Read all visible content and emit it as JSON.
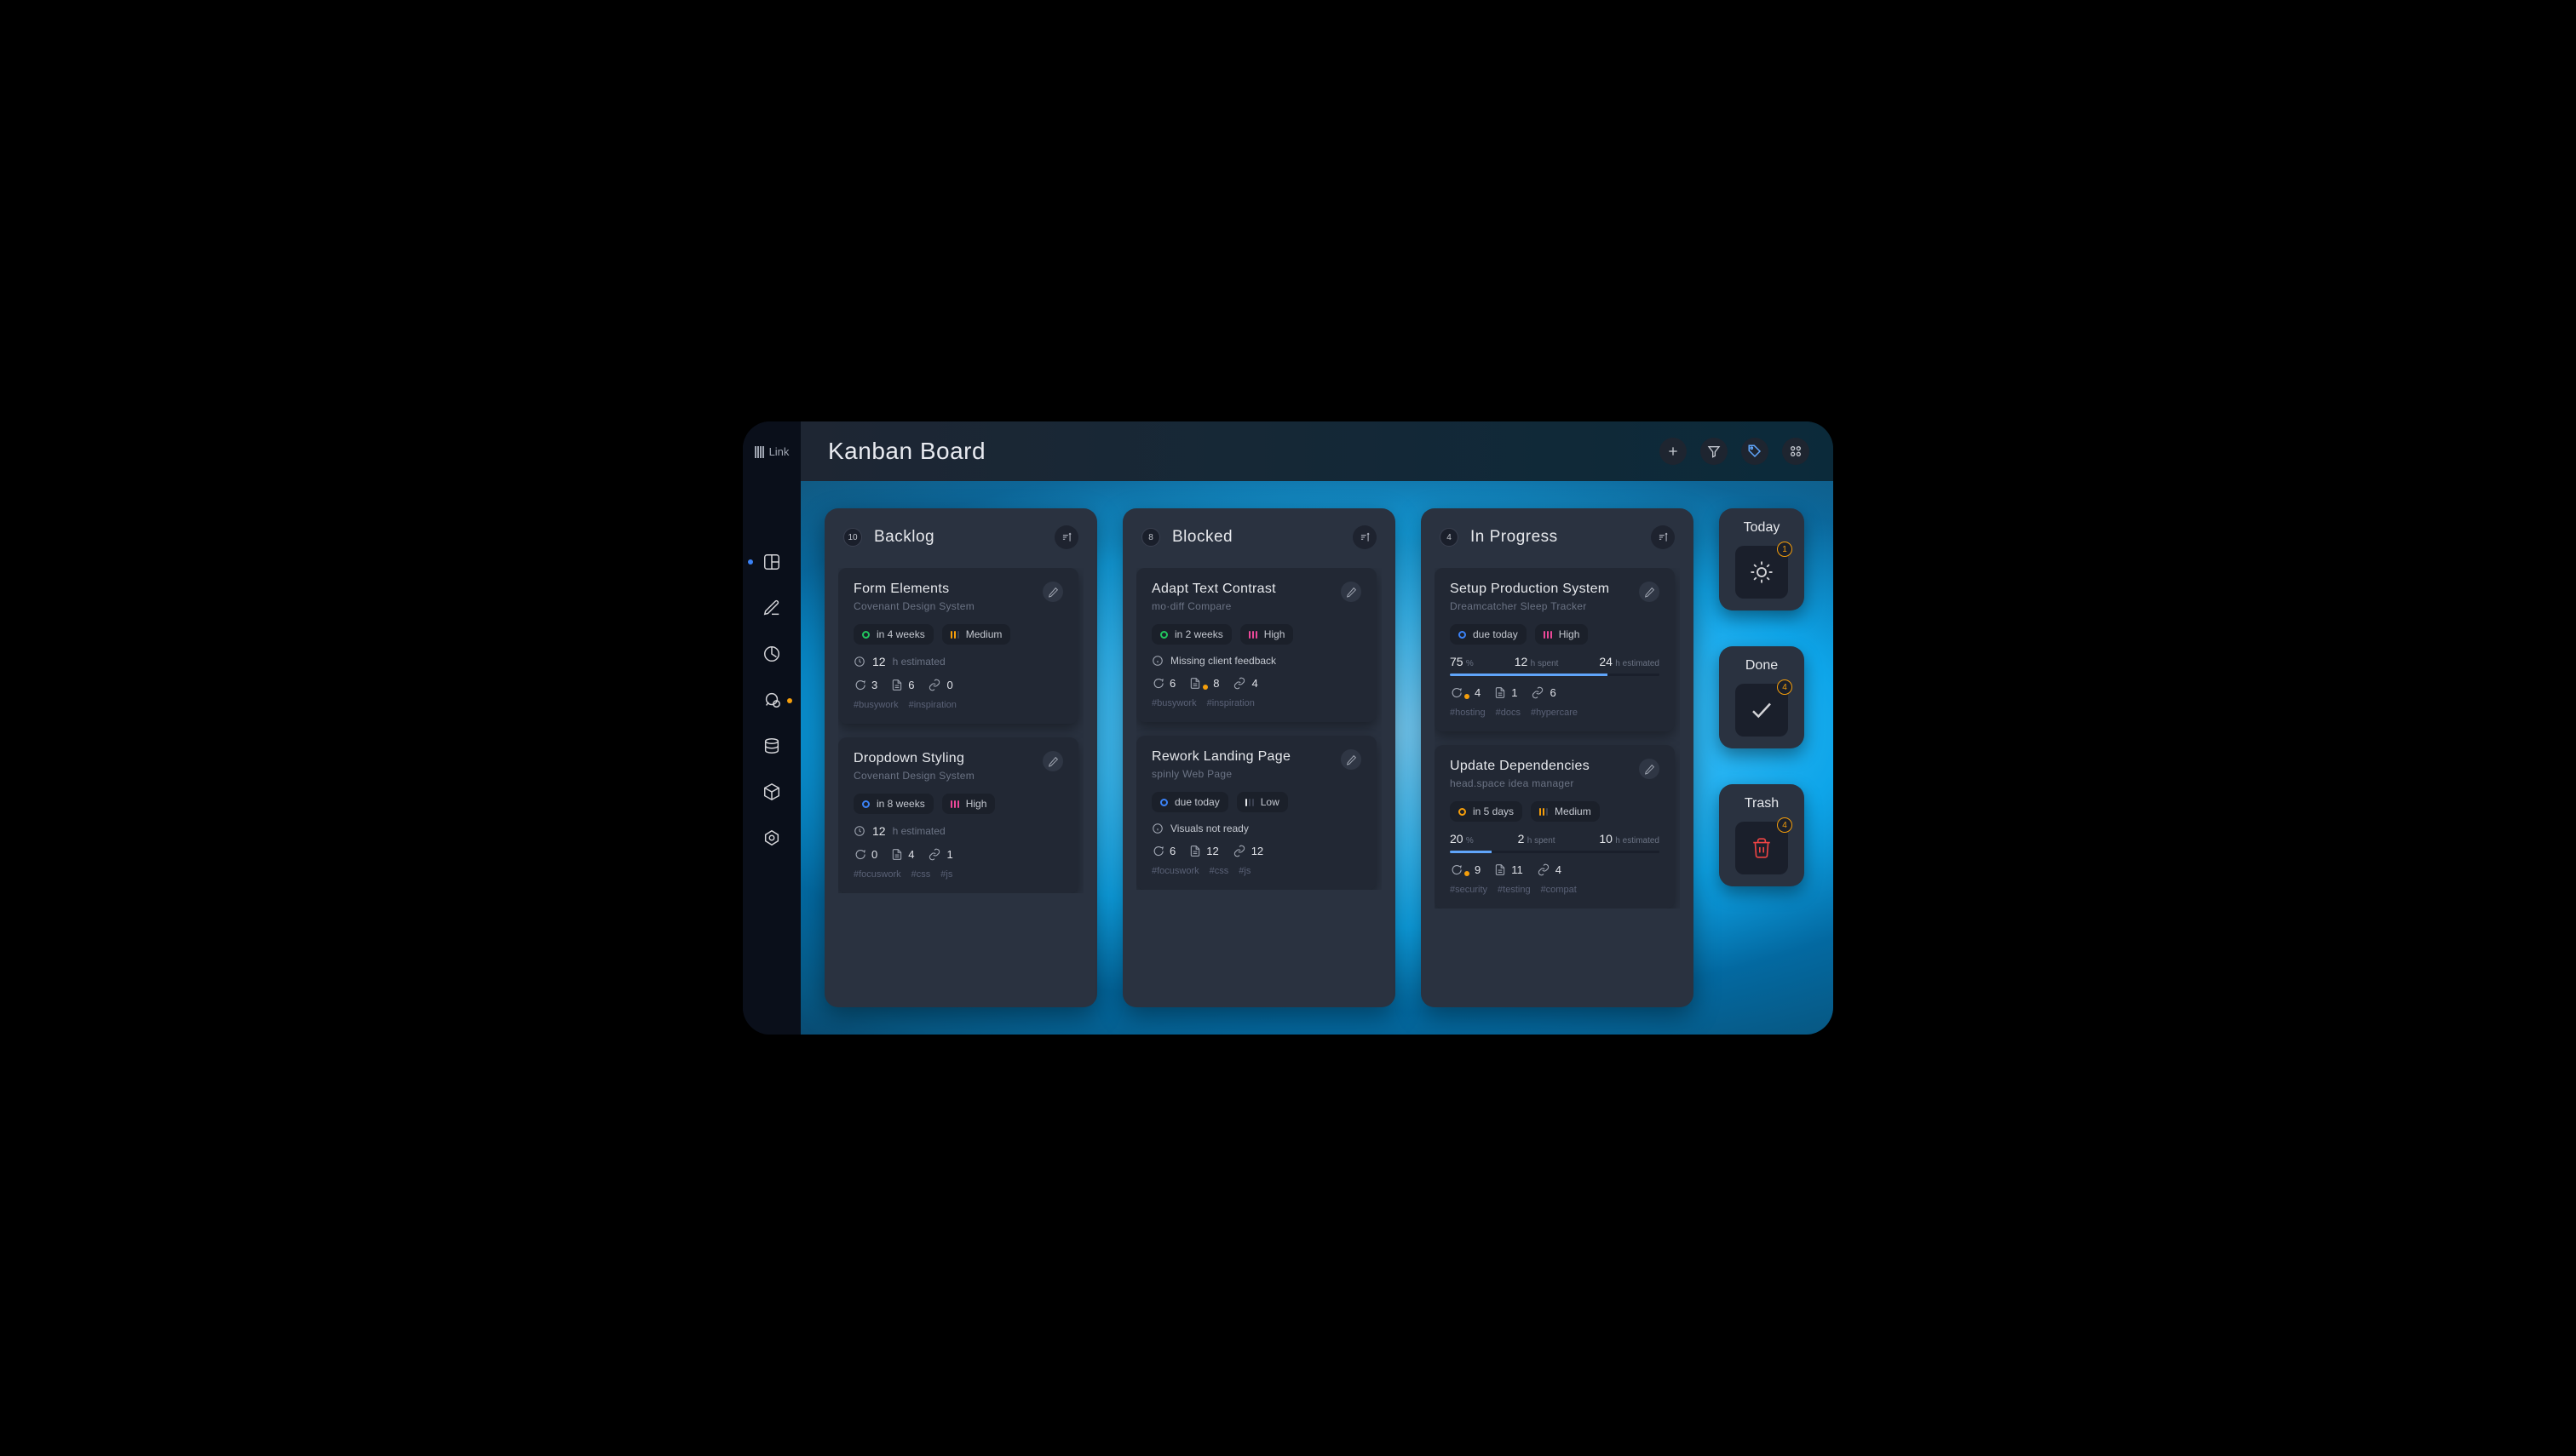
{
  "brand": {
    "name": "Link"
  },
  "header": {
    "title": "Kanban Board"
  },
  "columns": [
    {
      "count": "10",
      "title": "Backlog",
      "cards": [
        {
          "title": "Form Elements",
          "subtitle": "Covenant Design System",
          "due_label": "in 4 weeks",
          "due_color": "green",
          "priority": "Medium",
          "priority_bars": [
            "#f59e0b",
            "#f59e0b",
            "#3a4050"
          ],
          "estimate": "12",
          "estimate_suffix": "h estimated",
          "comments": "3",
          "files": "6",
          "links": "0",
          "comment_notif": false,
          "file_notif": false,
          "tags": [
            "#busywork",
            "#inspiration"
          ]
        },
        {
          "title": "Dropdown Styling",
          "subtitle": "Covenant Design System",
          "due_label": "in 8 weeks",
          "due_color": "blue",
          "priority": "High",
          "priority_bars": [
            "#ec4899",
            "#ec4899",
            "#ec4899"
          ],
          "estimate": "12",
          "estimate_suffix": "h estimated",
          "comments": "0",
          "files": "4",
          "links": "1",
          "comment_notif": false,
          "file_notif": false,
          "tags": [
            "#focuswork",
            "#css",
            "#js"
          ]
        }
      ]
    },
    {
      "count": "8",
      "title": "Blocked",
      "cards": [
        {
          "title": "Adapt Text Contrast",
          "subtitle": "mo·diff Compare",
          "due_label": "in 2 weeks",
          "due_color": "green",
          "priority": "High",
          "priority_bars": [
            "#ec4899",
            "#ec4899",
            "#ec4899"
          ],
          "blocked_reason": "Missing client feedback",
          "comments": "6",
          "files": "8",
          "links": "4",
          "comment_notif": false,
          "file_notif": true,
          "tags": [
            "#busywork",
            "#inspiration"
          ]
        },
        {
          "title": "Rework Landing Page",
          "subtitle": "spinly Web Page",
          "due_label": "due today",
          "due_color": "blue",
          "priority": "Low",
          "priority_bars": [
            "#e5e7eb",
            "#3a4050",
            "#3a4050"
          ],
          "blocked_reason": "Visuals not ready",
          "comments": "6",
          "files": "12",
          "links": "12",
          "comment_notif": false,
          "file_notif": false,
          "tags": [
            "#focuswork",
            "#css",
            "#js"
          ]
        }
      ]
    },
    {
      "count": "4",
      "title": "In Progress",
      "cards": [
        {
          "title": "Setup Production System",
          "subtitle": "Dreamcatcher Sleep Tracker",
          "due_label": "due today",
          "due_color": "blue",
          "priority": "High",
          "priority_bars": [
            "#ec4899",
            "#ec4899",
            "#ec4899"
          ],
          "progress_pct": "75",
          "spent": "12",
          "estimated": "24",
          "comments": "4",
          "files": "1",
          "links": "6",
          "comment_notif": true,
          "file_notif": false,
          "tags": [
            "#hosting",
            "#docs",
            "#hypercare"
          ]
        },
        {
          "title": "Update Dependencies",
          "subtitle": "head.space idea manager",
          "due_label": "in 5 days",
          "due_color": "orange",
          "priority": "Medium",
          "priority_bars": [
            "#f59e0b",
            "#f59e0b",
            "#3a4050"
          ],
          "progress_pct": "20",
          "spent": "2",
          "estimated": "10",
          "comments": "9",
          "files": "11",
          "links": "4",
          "comment_notif": true,
          "file_notif": false,
          "tags": [
            "#security",
            "#testing",
            "#compat"
          ]
        }
      ]
    }
  ],
  "side_panels": {
    "today": {
      "title": "Today",
      "badge": "1"
    },
    "done": {
      "title": "Done",
      "badge": "4"
    },
    "trash": {
      "title": "Trash",
      "badge": "4"
    }
  },
  "labels": {
    "pct_suffix": "%",
    "spent_suffix": "h spent",
    "est_suffix": "h estimated"
  }
}
